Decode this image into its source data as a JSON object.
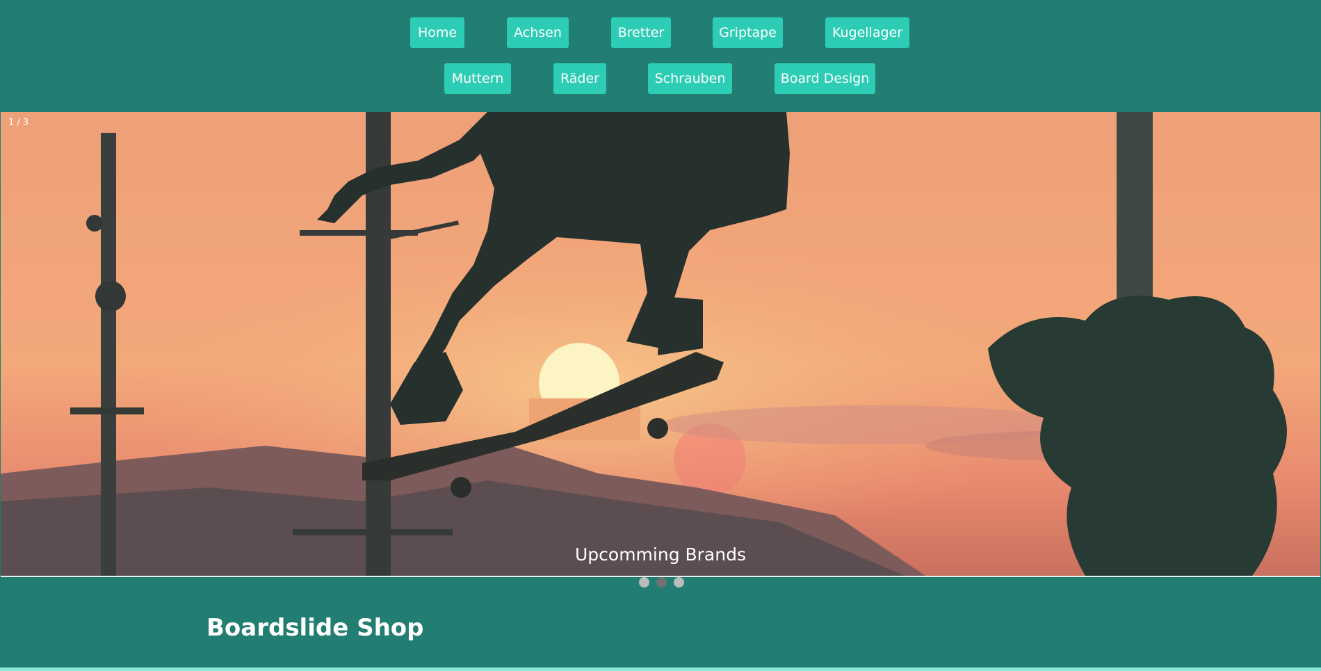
{
  "nav": {
    "row1": [
      "Home",
      "Achsen",
      "Bretter",
      "Griptape",
      "Kugellager"
    ],
    "row2": [
      "Muttern",
      "Räder",
      "Schrauben",
      "Board Design"
    ]
  },
  "slideshow": {
    "counter": "1 / 3",
    "caption": "Upcomming Brands",
    "total_slides": 3,
    "active_slide": 2
  },
  "footer": {
    "brand": "Boardslide Shop"
  },
  "colors": {
    "background": "#227e73",
    "nav_button": "#2dccb4",
    "bottom_line": "#8ee8d6"
  }
}
